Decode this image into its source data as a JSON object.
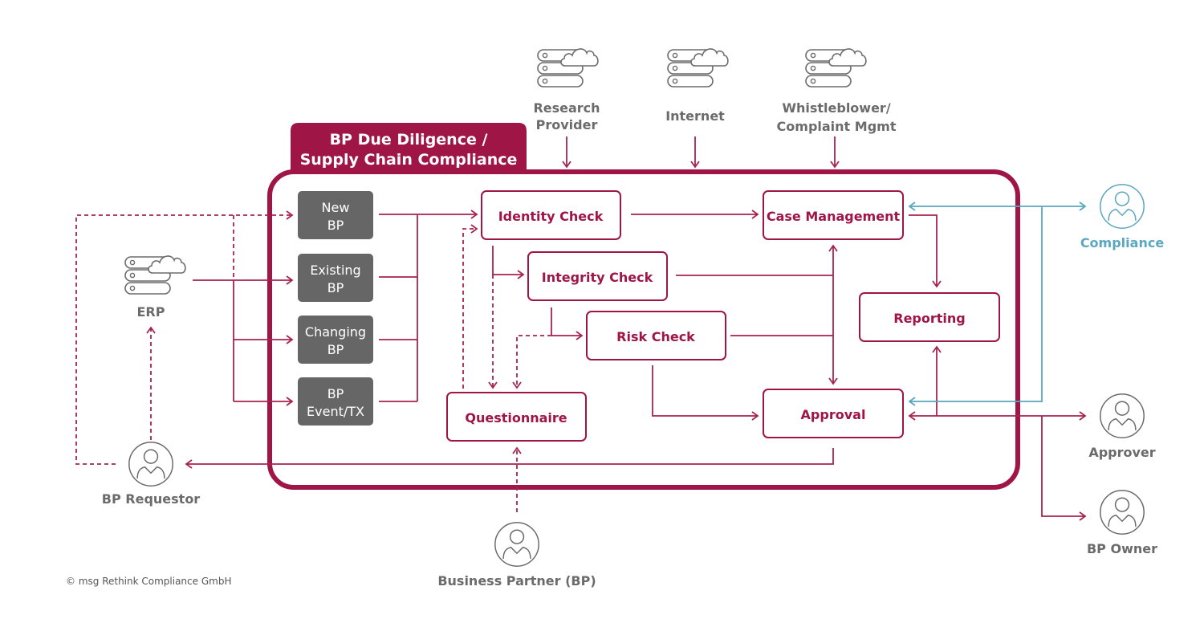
{
  "colors": {
    "brand": "#9e1546",
    "input_box": "#666666",
    "actor_gray": "#6b6b6b",
    "compliance_teal": "#5aa7bf"
  },
  "title": {
    "line1": "BP Due Diligence /",
    "line2": "Supply Chain Compliance"
  },
  "sources": [
    {
      "id": "research",
      "icon": "server-cloud-icon",
      "line1": "Research",
      "line2": "Provider"
    },
    {
      "id": "internet",
      "icon": "server-cloud-icon",
      "line1": "Internet",
      "line2": ""
    },
    {
      "id": "whistleblower",
      "icon": "server-cloud-icon",
      "line1": "Whistleblower/",
      "line2": "Complaint Mgmt"
    }
  ],
  "erp": {
    "icon": "server-cloud-icon",
    "label": "ERP"
  },
  "inputs": [
    {
      "id": "new-bp",
      "line1": "New",
      "line2": "BP"
    },
    {
      "id": "existing-bp",
      "line1": "Existing",
      "line2": "BP"
    },
    {
      "id": "changing-bp",
      "line1": "Changing",
      "line2": "BP"
    },
    {
      "id": "bp-event",
      "line1": "BP",
      "line2": "Event/TX"
    }
  ],
  "process": {
    "identity_check": "Identity Check",
    "integrity_check": "Integrity Check",
    "risk_check": "Risk Check",
    "questionnaire": "Questionnaire",
    "case_management": "Case Management",
    "reporting": "Reporting",
    "approval": "Approval"
  },
  "actors": {
    "bp_requestor": {
      "icon": "user-icon",
      "label": "BP Requestor"
    },
    "business_partner": {
      "icon": "user-icon",
      "label": "Business Partner (BP)"
    },
    "compliance": {
      "icon": "user-icon",
      "label": "Compliance"
    },
    "approver": {
      "icon": "user-icon",
      "label": "Approver"
    },
    "bp_owner": {
      "icon": "user-icon",
      "label": "BP Owner"
    }
  },
  "copyright": "© msg Rethink Compliance GmbH"
}
